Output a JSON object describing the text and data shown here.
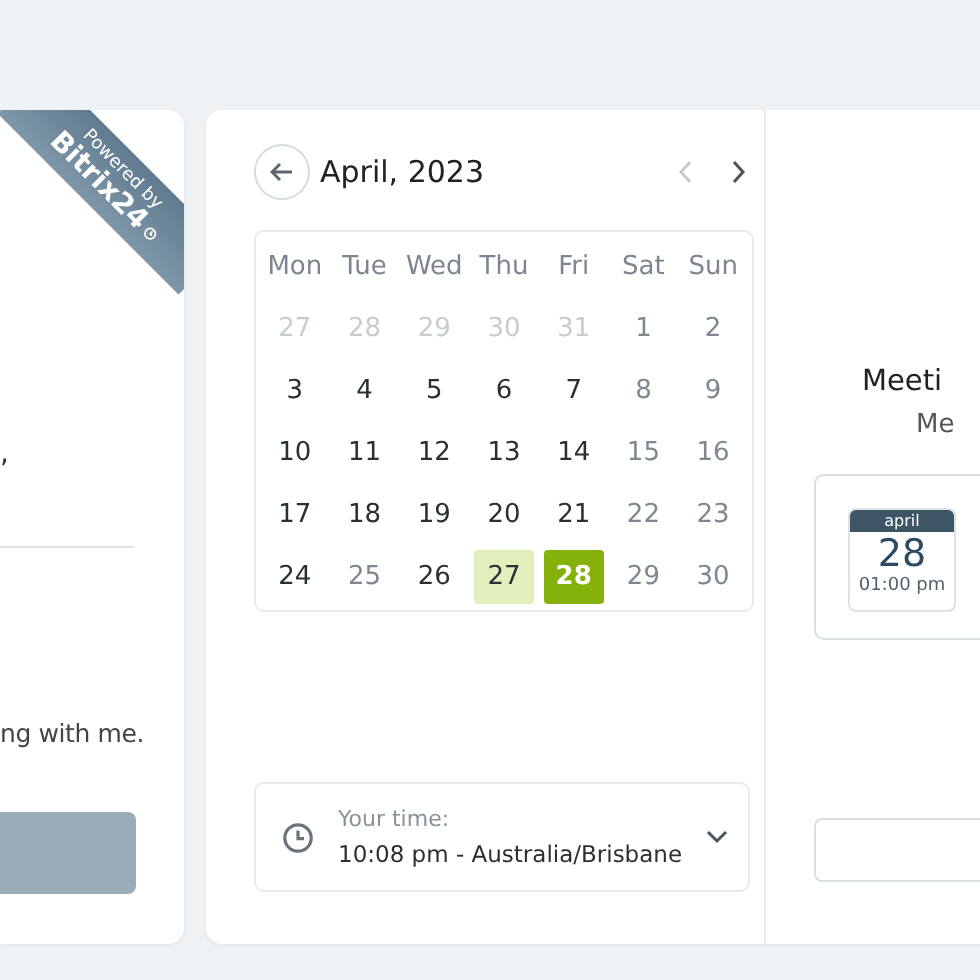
{
  "ribbon": {
    "line_1": "Powered by",
    "line_2": "Bitrix24"
  },
  "form": {
    "fragment": ",",
    "message": "ng with me."
  },
  "calendar": {
    "title": "April, 2023",
    "prev_disabled": true,
    "next_disabled": false,
    "weekdays": [
      "Mon",
      "Tue",
      "Wed",
      "Thu",
      "Fri",
      "Sat",
      "Sun"
    ],
    "weeks": [
      [
        {
          "label": "27",
          "kind": "outside",
          "selected": false,
          "today": false
        },
        {
          "label": "28",
          "kind": "outside",
          "selected": false,
          "today": false
        },
        {
          "label": "29",
          "kind": "outside",
          "selected": false,
          "today": false
        },
        {
          "label": "30",
          "kind": "outside",
          "selected": false,
          "today": false
        },
        {
          "label": "31",
          "kind": "outside",
          "selected": false,
          "today": false
        },
        {
          "label": "1",
          "kind": "off",
          "selected": false,
          "today": false
        },
        {
          "label": "2",
          "kind": "off",
          "selected": false,
          "today": false
        }
      ],
      [
        {
          "label": "3",
          "kind": "open",
          "selected": false,
          "today": false
        },
        {
          "label": "4",
          "kind": "open",
          "selected": false,
          "today": false
        },
        {
          "label": "5",
          "kind": "open",
          "selected": false,
          "today": false
        },
        {
          "label": "6",
          "kind": "open",
          "selected": false,
          "today": false
        },
        {
          "label": "7",
          "kind": "open",
          "selected": false,
          "today": false
        },
        {
          "label": "8",
          "kind": "off",
          "selected": false,
          "today": false
        },
        {
          "label": "9",
          "kind": "off",
          "selected": false,
          "today": false
        }
      ],
      [
        {
          "label": "10",
          "kind": "open",
          "selected": false,
          "today": false
        },
        {
          "label": "11",
          "kind": "open",
          "selected": false,
          "today": false
        },
        {
          "label": "12",
          "kind": "open",
          "selected": false,
          "today": false
        },
        {
          "label": "13",
          "kind": "open",
          "selected": false,
          "today": false
        },
        {
          "label": "14",
          "kind": "open",
          "selected": false,
          "today": false
        },
        {
          "label": "15",
          "kind": "off",
          "selected": false,
          "today": false
        },
        {
          "label": "16",
          "kind": "off",
          "selected": false,
          "today": false
        }
      ],
      [
        {
          "label": "17",
          "kind": "open",
          "selected": false,
          "today": false
        },
        {
          "label": "18",
          "kind": "open",
          "selected": false,
          "today": false
        },
        {
          "label": "19",
          "kind": "open",
          "selected": false,
          "today": false
        },
        {
          "label": "20",
          "kind": "open",
          "selected": false,
          "today": false
        },
        {
          "label": "21",
          "kind": "open",
          "selected": false,
          "today": false
        },
        {
          "label": "22",
          "kind": "off",
          "selected": false,
          "today": false
        },
        {
          "label": "23",
          "kind": "off",
          "selected": false,
          "today": false
        }
      ],
      [
        {
          "label": "24",
          "kind": "open",
          "selected": false,
          "today": false
        },
        {
          "label": "25",
          "kind": "off",
          "selected": false,
          "today": false
        },
        {
          "label": "26",
          "kind": "open",
          "selected": false,
          "today": false
        },
        {
          "label": "27",
          "kind": "open",
          "selected": false,
          "today": true
        },
        {
          "label": "28",
          "kind": "open",
          "selected": true,
          "today": false
        },
        {
          "label": "29",
          "kind": "off",
          "selected": false,
          "today": false
        },
        {
          "label": "30",
          "kind": "off",
          "selected": false,
          "today": false
        }
      ]
    ]
  },
  "timezone": {
    "label": "Your time:",
    "value": "10:08 pm - Australia/Brisbane"
  },
  "meeting": {
    "title": "Meeti",
    "subtitle": "Me",
    "slot": {
      "month": "april",
      "day": "28",
      "time": "01:00 pm"
    }
  }
}
